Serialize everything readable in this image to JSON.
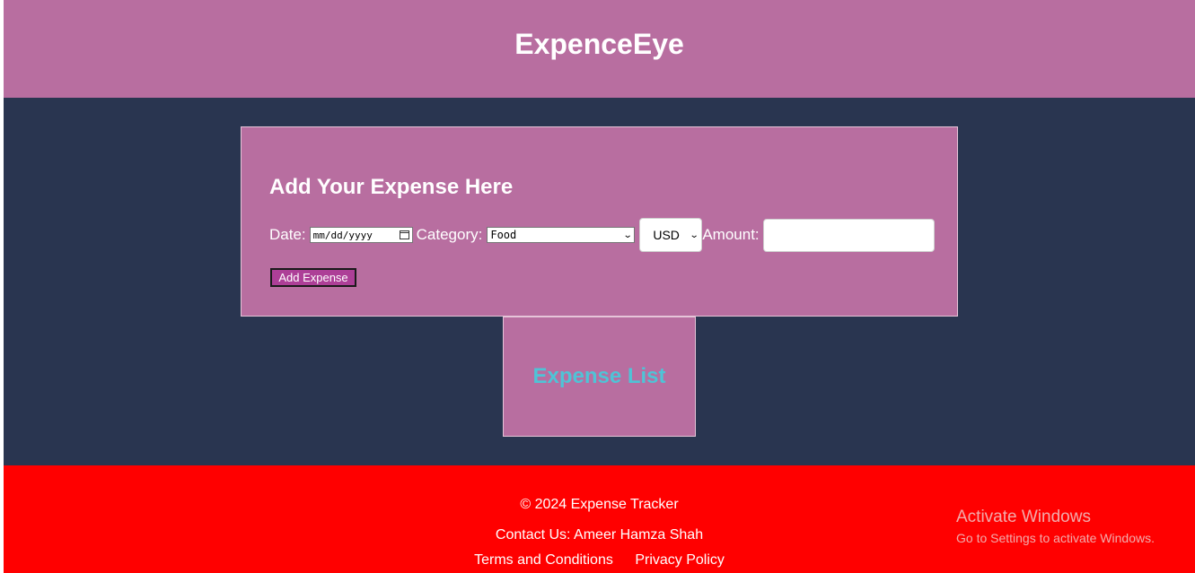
{
  "header": {
    "title": "ExpenceEye"
  },
  "form": {
    "heading": "Add Your Expense Here",
    "date_label": "Date:",
    "date_placeholder": "mm/dd/yyyy",
    "category_label": "Category:",
    "category_selected": "Food",
    "currency_selected": "USD",
    "amount_label": "Amount:",
    "amount_value": "",
    "submit_label": "Add Expense"
  },
  "expense_list": {
    "heading": "Expense List"
  },
  "footer": {
    "copyright": "© 2024 Expense Tracker",
    "contact": "Contact Us: Ameer Hamza Shah",
    "links": [
      "Terms and Conditions",
      "Privacy Policy"
    ]
  },
  "watermark": {
    "title": "Activate Windows",
    "subtitle": "Go to Settings to activate Windows."
  },
  "colors": {
    "header_bg": "#b86ea0",
    "body_bg": "#293550",
    "card_bg": "#b86ea0",
    "button_bg": "#ad3f97",
    "list_heading": "#4fc3d6",
    "footer_bg": "#ff0000"
  }
}
